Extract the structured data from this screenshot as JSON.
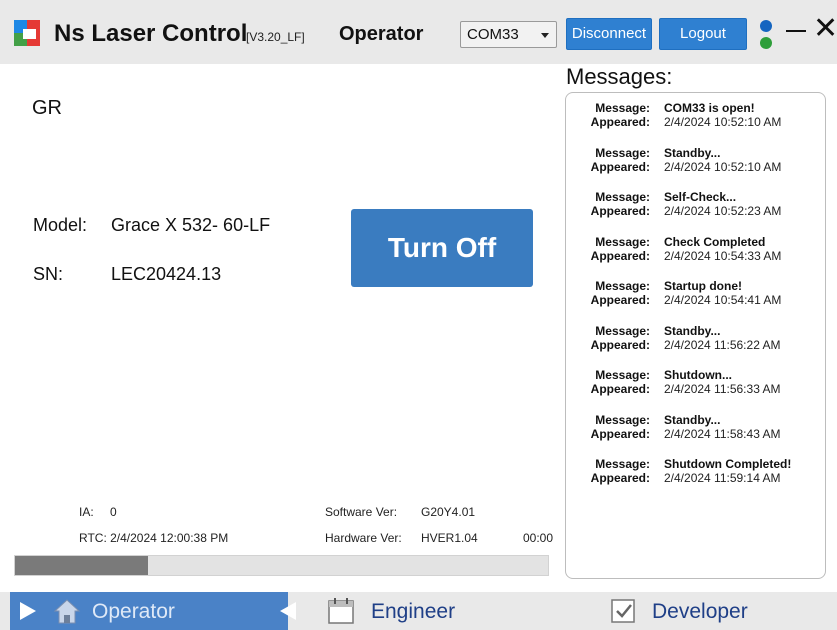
{
  "titlebar": {
    "app_title": "Ns Laser Control",
    "version": "[V3.20_LF]",
    "user_role": "Operator",
    "port_selected": "COM33",
    "disconnect_label": "Disconnect",
    "logout_label": "Logout"
  },
  "device": {
    "name": "GR",
    "model_label": "Model:",
    "model_value": "Grace X 532- 60-LF",
    "sn_label": "SN:",
    "sn_value": "LEC20424.13",
    "turn_off_label": "Turn Off"
  },
  "info": {
    "ia_label": "IA:",
    "ia_value": "0",
    "rtc": "RTC: 2/4/2024 12:00:38 PM",
    "software_label": "Software Ver:",
    "software_value": "G20Y4.01",
    "hardware_label": "Hardware Ver:",
    "hardware_value": "HVER1.04",
    "timer": "00:00",
    "progress_fraction": 0.25
  },
  "messages": {
    "title": "Messages:",
    "message_label": "Message:",
    "appeared_label": "Appeared:",
    "items": [
      {
        "message": "COM33 is open!",
        "appeared": "2/4/2024 10:52:10 AM"
      },
      {
        "message": "Standby...",
        "appeared": "2/4/2024 10:52:10 AM"
      },
      {
        "message": "Self-Check...",
        "appeared": "2/4/2024 10:52:23 AM"
      },
      {
        "message": "Check Completed",
        "appeared": "2/4/2024 10:54:33 AM"
      },
      {
        "message": "Startup done!",
        "appeared": "2/4/2024 10:54:41 AM"
      },
      {
        "message": "Standby...",
        "appeared": "2/4/2024 11:56:22 AM"
      },
      {
        "message": "Shutdown...",
        "appeared": "2/4/2024 11:56:33 AM"
      },
      {
        "message": "Standby...",
        "appeared": "2/4/2024 11:58:43 AM"
      },
      {
        "message": "Shutdown Completed!",
        "appeared": "2/4/2024 11:59:14 AM"
      }
    ]
  },
  "nav": {
    "operator": "Operator",
    "engineer": "Engineer",
    "developer": "Developer"
  },
  "icons": {
    "app": "app-logo-icon",
    "home": "home-icon",
    "calendar": "calendar-icon",
    "checklist": "checklist-icon"
  },
  "colors": {
    "accent_blue": "#2f80d1",
    "nav_active": "#4a82c7",
    "status_blue": "#1565c0",
    "status_green": "#2e9e3a"
  }
}
